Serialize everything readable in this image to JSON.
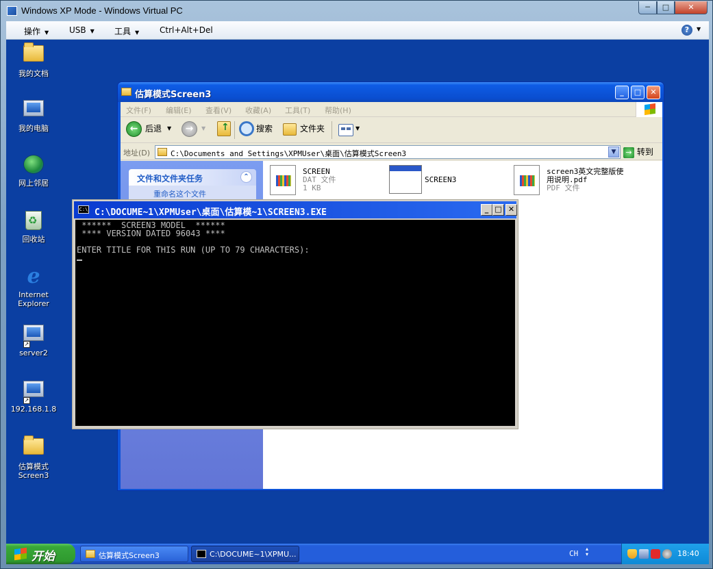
{
  "host": {
    "title": "Windows XP Mode - Windows Virtual PC",
    "min_glyph": "─",
    "max_glyph": "□",
    "close_glyph": "✕",
    "menu": [
      {
        "label": "操作"
      },
      {
        "label": "USB"
      },
      {
        "label": "工具"
      },
      {
        "label": "Ctrl+Alt+Del"
      }
    ],
    "help_glyph": "?"
  },
  "desktop": {
    "icons": [
      {
        "label": "我的文档"
      },
      {
        "label": "我的电脑"
      },
      {
        "label": "网上邻居"
      },
      {
        "label": "回收站"
      },
      {
        "label": "Internet Explorer"
      },
      {
        "label": "server2"
      },
      {
        "label": "192.168.1.8"
      },
      {
        "label": "估算模式 Screen3"
      }
    ]
  },
  "explorer": {
    "title": "估算模式Screen3",
    "menu": [
      "文件(F)",
      "编辑(E)",
      "查看(V)",
      "收藏(A)",
      "工具(T)",
      "帮助(H)"
    ],
    "toolbar": {
      "back": "后退",
      "search": "搜索",
      "folders": "文件夹"
    },
    "address": {
      "label": "地址(D)",
      "value": "C:\\Documents and Settings\\XPMUser\\桌面\\估算模式Screen3",
      "go": "转到"
    },
    "tasks": {
      "header": "文件和文件夹任务",
      "item": "重命名这个文件"
    },
    "files": [
      {
        "name": "SCREEN",
        "type": "DAT 文件",
        "size": "1 KB"
      },
      {
        "name": "SCREEN3"
      },
      {
        "name": "screen3英文完整版使用说明.pdf",
        "name_line1": "screen3英文完整版使",
        "name_line2": "用说明.pdf",
        "type": "PDF 文件"
      }
    ]
  },
  "console": {
    "title": "C:\\DOCUME~1\\XPMUser\\桌面\\估算模~1\\SCREEN3.EXE",
    "icon_text": "C:\\",
    "lines": [
      " ******  SCREEN3 MODEL  ******",
      " **** VERSION DATED 96043 ****",
      "",
      "ENTER TITLE FOR THIS RUN (UP TO 79 CHARACTERS):"
    ]
  },
  "taskbar": {
    "start_label": "开始",
    "buttons": [
      {
        "label": "估算模式Screen3"
      },
      {
        "label": "C:\\DOCUME~1\\XPMU..."
      }
    ],
    "language": "CH",
    "clock": "18:40"
  },
  "colors": {
    "desktop_bg": "#0b3fa2",
    "xp_title_blue": "#0a4ed0",
    "console_bg": "#000000",
    "start_green": "#38a838"
  }
}
